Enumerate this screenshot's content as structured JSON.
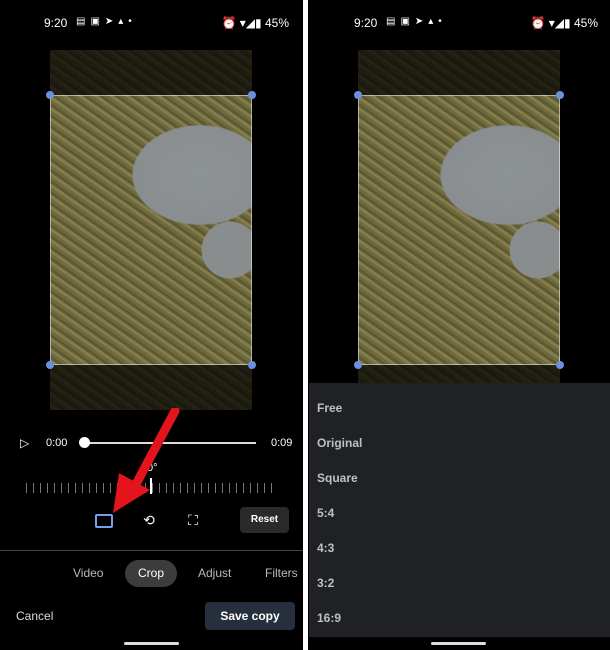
{
  "status_bar": {
    "time": "9:20",
    "battery": "45%",
    "icons": [
      "notes-icon",
      "calendar-icon",
      "telegram-icon",
      "photos-icon",
      "dot-icon",
      "alarm-icon",
      "wifi-icon",
      "signal-icon",
      "battery-icon"
    ]
  },
  "player": {
    "current_time": "0:00",
    "duration": "0:09",
    "progress": 0
  },
  "straighten": {
    "angle": "0°"
  },
  "tools": {
    "reset_label": "Reset",
    "accent": "#7c9be8"
  },
  "tabs": [
    {
      "label": "Video"
    },
    {
      "label": "Crop",
      "active": true
    },
    {
      "label": "Adjust"
    },
    {
      "label": "Filters"
    }
  ],
  "actions": {
    "cancel": "Cancel",
    "save": "Save copy"
  },
  "aspect_menu": {
    "items": [
      "Free",
      "Original",
      "Square",
      "5:4",
      "4:3",
      "3:2",
      "16:9"
    ]
  },
  "annotation": {
    "arrow_color": "#e3141b"
  }
}
